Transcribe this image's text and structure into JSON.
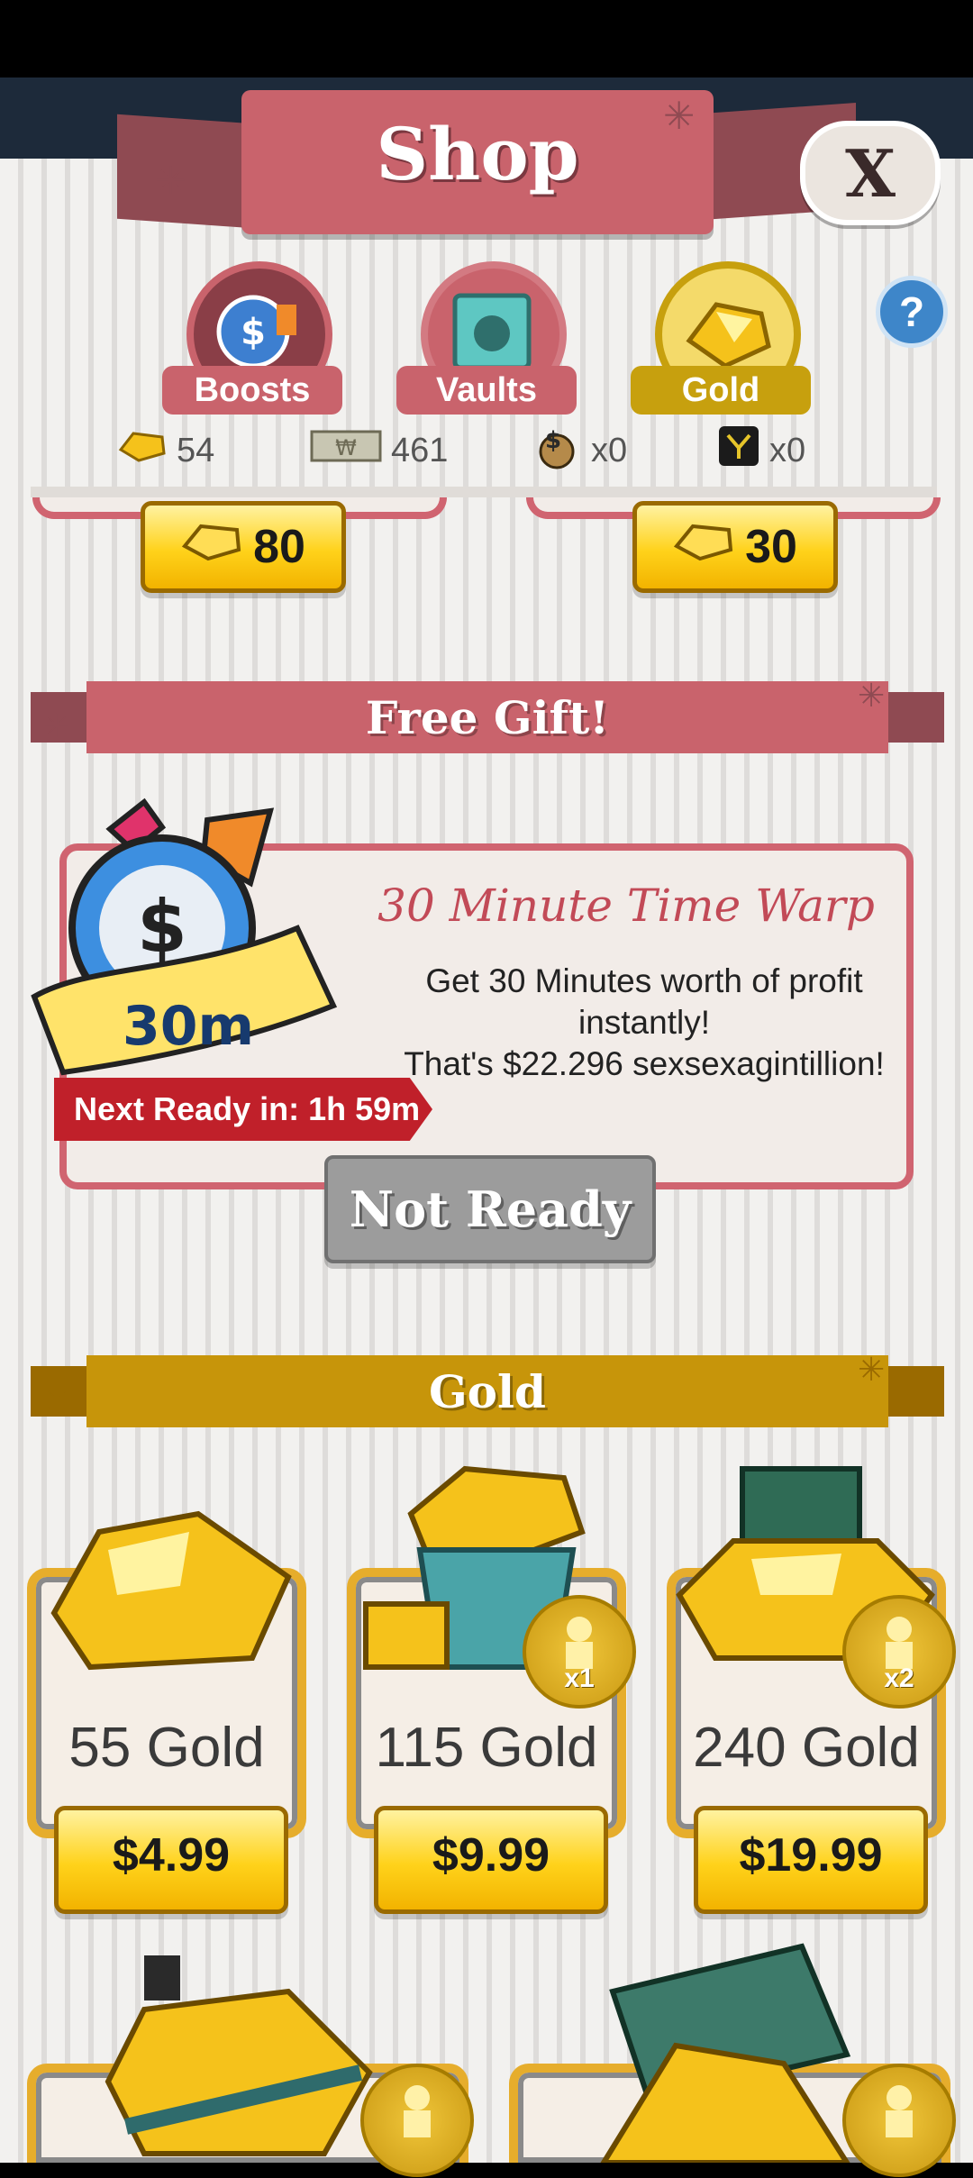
{
  "header": {
    "title": "Shop",
    "close_label": "X"
  },
  "tabs": [
    {
      "label": "Boosts",
      "active": false
    },
    {
      "label": "Vaults",
      "active": false
    },
    {
      "label": "Gold",
      "active": true
    }
  ],
  "help_label": "?",
  "currencies": [
    {
      "icon": "gold-bar-icon",
      "value": "54"
    },
    {
      "icon": "megabucks-icon",
      "value": "461"
    },
    {
      "icon": "money-bag-icon",
      "value": "x0"
    },
    {
      "icon": "megaticket-icon",
      "value": "x0"
    }
  ],
  "prev_row": {
    "left_price": "80",
    "right_price": "30"
  },
  "free_gift": {
    "section_title": "Free Gift!",
    "badge": "30m",
    "title": "30 Minute Time Warp",
    "desc_line1": "Get 30 Minutes worth of profit",
    "desc_line2": "instantly!",
    "desc_line3": "That's $22.296 sexsexagintillion!",
    "next_ready": "Next Ready in: 1h 59m",
    "button": "Not Ready"
  },
  "gold": {
    "section_title": "Gold",
    "items": [
      {
        "label": "55 Gold",
        "price": "$4.99",
        "bonus": ""
      },
      {
        "label": "115 Gold",
        "price": "$9.99",
        "bonus": "x1"
      },
      {
        "label": "240 Gold",
        "price": "$19.99",
        "bonus": "x2"
      }
    ]
  },
  "colors": {
    "accent": "#c9636c",
    "gold": "#c7950a",
    "panel": "#f2f1ef"
  }
}
